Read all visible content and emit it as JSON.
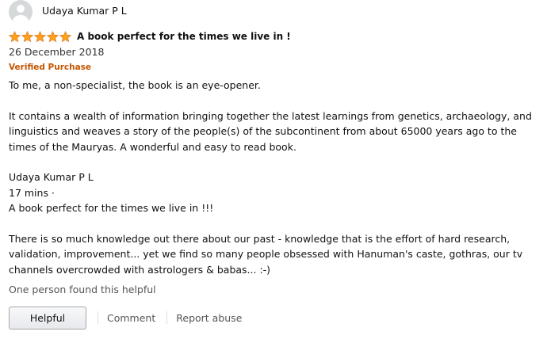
{
  "profile": {
    "name": "Udaya Kumar P L",
    "avatar_icon": "user-silhouette-icon"
  },
  "review": {
    "rating": 5,
    "rating_max": 5,
    "star_color": "#ffa41c",
    "star_outline": "#de7921",
    "title": "A book perfect for the times we live in !",
    "date": "26 December 2018",
    "verified_label": "Verified Purchase",
    "verified_color": "#c45500",
    "body": {
      "p1": "To me, a non-specialist, the book is an eye-opener.",
      "p2": "It contains a wealth of information bringing together the latest learnings from genetics, archaeology, and linguistics and weaves a story of the people(s) of the subcontinent from about 65000 years ago to the times of the Mauryas. A wonderful and easy to read book.",
      "quoted_author": "Udaya Kumar P L",
      "quoted_time": "17 mins ·",
      "quoted_title": "A book perfect for the times we live in !!!",
      "p4": "There is so much knowledge out there about our past - knowledge that is the effort of hard research, validation, improvement... yet we find so many people obsessed with Hanuman's caste, gothras, our tv channels overcrowded with astrologers & babas... :-)"
    },
    "helpful_count": "One person found this helpful"
  },
  "actions": {
    "helpful_label": "Helpful",
    "comment_label": "Comment",
    "report_label": "Report abuse"
  }
}
